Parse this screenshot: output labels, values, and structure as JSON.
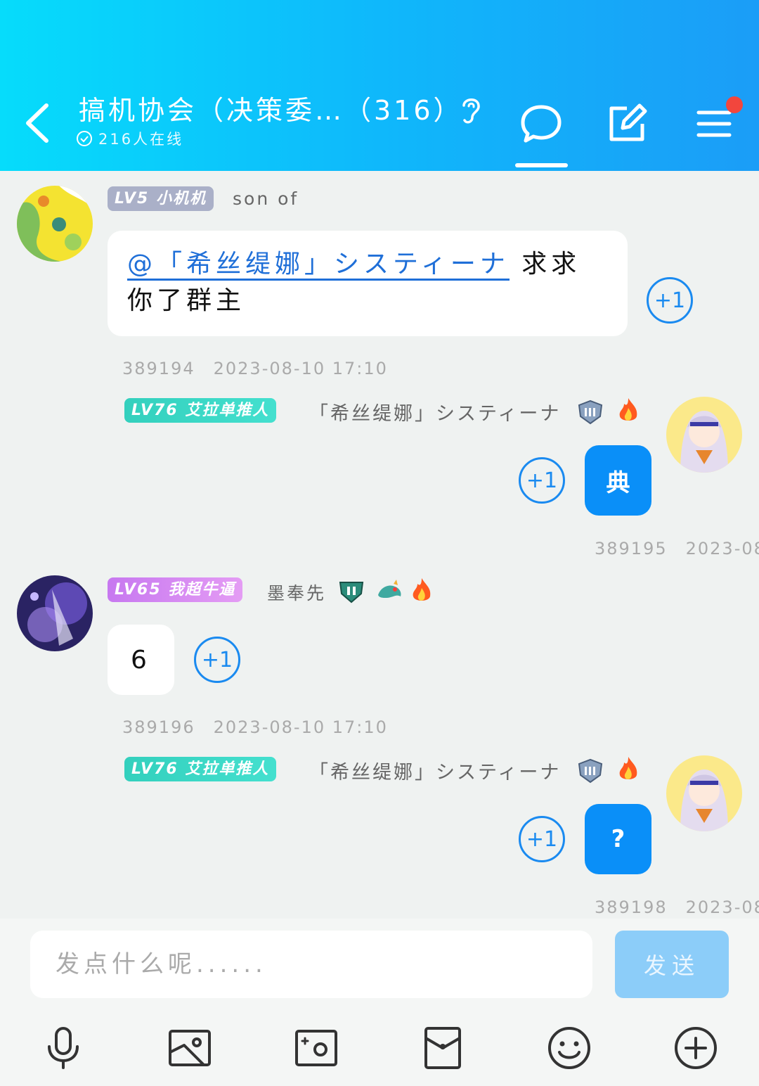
{
  "header": {
    "title": "搞机协会（决策委…（316）",
    "online": "216人在线",
    "icons": [
      "back-icon",
      "ear-icon",
      "chat-icon",
      "edit-icon",
      "menu-icon"
    ]
  },
  "messages": [
    {
      "level": "LV5",
      "title": "小机机",
      "nick": "son of",
      "mention": "@「希丝缇娜」システィーナ",
      "text": "求求你了群主",
      "plus": "+1",
      "id": "389194",
      "time": "2023-08-10 17:10"
    },
    {
      "level": "LV76",
      "title": "艾拉单推人",
      "nick": "「希丝缇娜」システィーナ",
      "text": "典",
      "plus": "+1",
      "id": "389195",
      "time": "2023-08-"
    },
    {
      "level": "LV65",
      "title": "我超牛逼",
      "nick": "墨奉先",
      "text": "6",
      "plus": "+1",
      "id": "389196",
      "time": "2023-08-10 17:10"
    },
    {
      "level": "LV76",
      "title": "艾拉单推人",
      "nick": "「希丝缇娜」システィーナ",
      "text": "?",
      "plus": "+1",
      "id": "389198",
      "time": "2023-08-"
    }
  ],
  "composer": {
    "placeholder": "发点什么呢......",
    "send_label": "发送",
    "tools": [
      "microphone-icon",
      "image-icon",
      "camera-icon",
      "red-packet-icon",
      "emoji-icon",
      "plus-icon"
    ]
  },
  "colors": {
    "header_start": "#06dcfb",
    "header_end": "#1b9df7",
    "accent_blue": "#0a8ff8",
    "send_disabled": "#8ccdf9"
  }
}
